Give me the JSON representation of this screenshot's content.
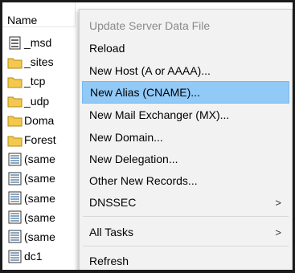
{
  "list": {
    "header": "Name",
    "rows": [
      {
        "label": "_msd",
        "icon": "zone-file-icon"
      },
      {
        "label": "_sites",
        "icon": "folder-icon"
      },
      {
        "label": "_tcp",
        "icon": "folder-icon"
      },
      {
        "label": "_udp",
        "icon": "folder-icon"
      },
      {
        "label": "Doma",
        "icon": "folder-icon"
      },
      {
        "label": "Forest",
        "icon": "folder-icon"
      },
      {
        "label": "(same",
        "icon": "record-icon"
      },
      {
        "label": "(same",
        "icon": "record-icon"
      },
      {
        "label": "(same",
        "icon": "record-icon"
      },
      {
        "label": "(same",
        "icon": "record-icon"
      },
      {
        "label": "(same",
        "icon": "record-icon"
      },
      {
        "label": "dc1",
        "icon": "record-icon"
      }
    ]
  },
  "menu": {
    "items": [
      {
        "label": "Update Server Data File",
        "disabled": true
      },
      {
        "label": "Reload"
      },
      {
        "label": "New Host (A or AAAA)..."
      },
      {
        "label": "New Alias (CNAME)...",
        "highlighted": true
      },
      {
        "label": "New Mail Exchanger (MX)..."
      },
      {
        "label": "New Domain..."
      },
      {
        "label": "New Delegation..."
      },
      {
        "label": "Other New Records..."
      },
      {
        "label": "DNSSEC",
        "submenu": true
      },
      {
        "label": "All Tasks",
        "submenu": true
      },
      {
        "label": "Refresh"
      }
    ],
    "submenu_arrow": ">"
  },
  "colors": {
    "highlight": "#91c9f7",
    "folder": "#f2c94c",
    "menu_bg": "#f2f2f2",
    "disabled_text": "#8a8a8a"
  }
}
